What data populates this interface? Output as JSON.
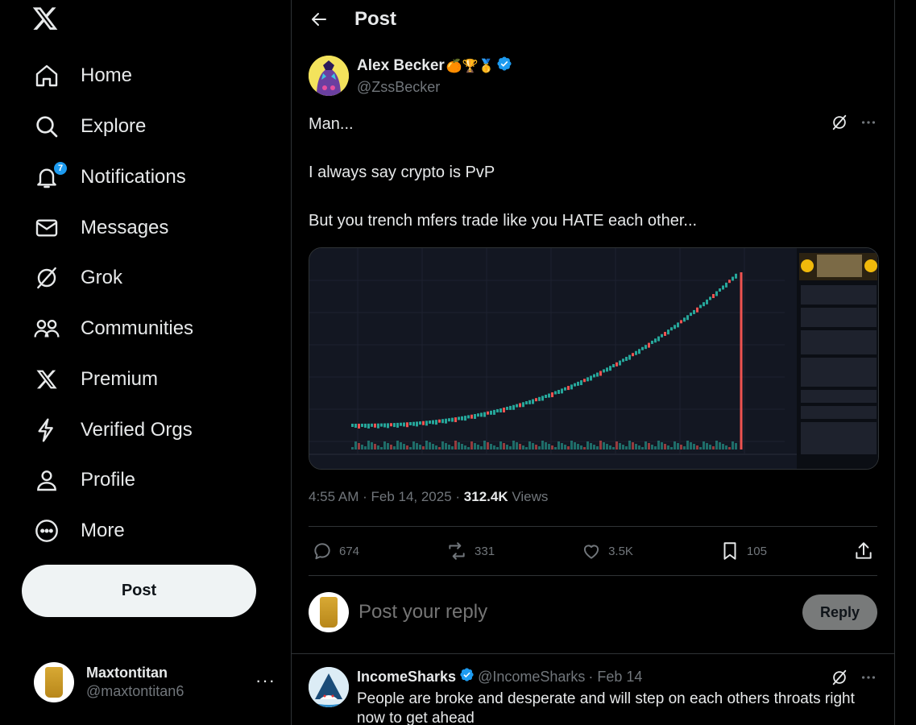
{
  "sidebar": {
    "logo": "x-logo-icon",
    "items": [
      {
        "label": "Home",
        "icon": "home-icon"
      },
      {
        "label": "Explore",
        "icon": "search-icon"
      },
      {
        "label": "Notifications",
        "icon": "bell-icon",
        "badge": "7"
      },
      {
        "label": "Messages",
        "icon": "envelope-icon"
      },
      {
        "label": "Grok",
        "icon": "grok-icon"
      },
      {
        "label": "Communities",
        "icon": "people-icon"
      },
      {
        "label": "Premium",
        "icon": "x-logo-icon"
      },
      {
        "label": "Verified Orgs",
        "icon": "lightning-icon"
      },
      {
        "label": "Profile",
        "icon": "person-icon"
      },
      {
        "label": "More",
        "icon": "more-circle-icon"
      }
    ],
    "post_label": "Post",
    "account": {
      "name": "Maxtontitan",
      "handle": "@maxtontitan6",
      "more": "···"
    }
  },
  "header": {
    "title": "Post"
  },
  "tweet": {
    "author_name": "Alex Becker",
    "author_emojis": "🍊🏆🥇",
    "author_handle": "@ZssBecker",
    "lines": [
      "Man...",
      "I always say crypto is PvP",
      "But you trench mfers trade like you HATE each other..."
    ],
    "time": "4:55 AM · Feb 14, 2025 · ",
    "views_count": "312.4K",
    "views_label": " Views",
    "replies": "674",
    "reposts": "331",
    "likes": "3.5K",
    "bookmarks": "105"
  },
  "reply_composer": {
    "placeholder": "Post your reply",
    "button": "Reply"
  },
  "reply": {
    "name": "IncomeSharks",
    "handle": "@IncomeSharks",
    "date": "· Feb 14",
    "text": "People are broke and desperate and will step on each others throats right now to get ahead"
  },
  "colors": {
    "accent": "#1d9bf0",
    "verified": "#1d9bf0",
    "muted": "#71767b",
    "border": "#2f3336",
    "candle_up": "#26a69a",
    "candle_down": "#ef5350"
  }
}
